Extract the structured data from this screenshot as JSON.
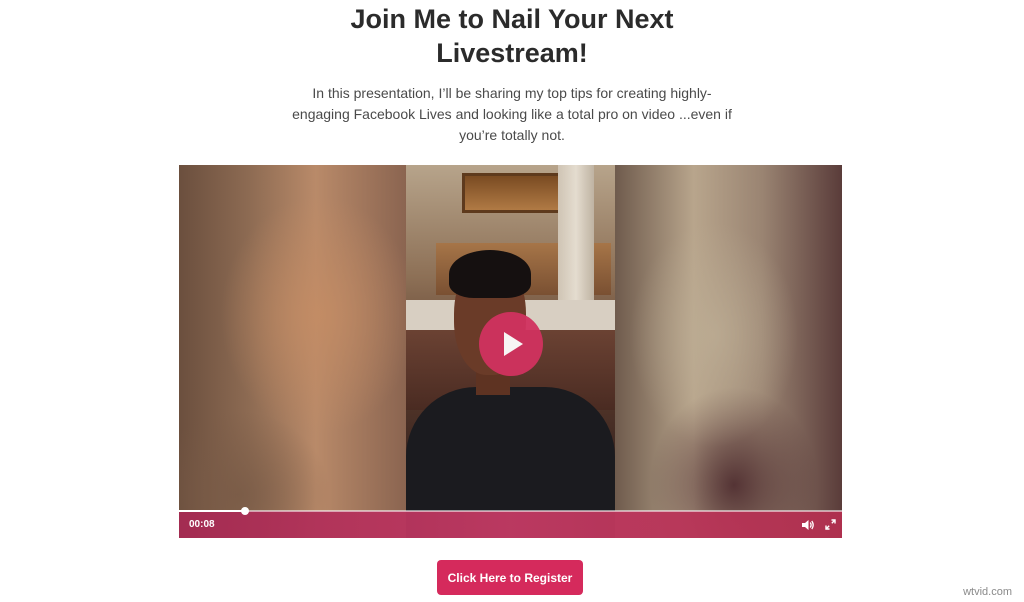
{
  "heading": {
    "line1": "Join Me to Nail Your Next",
    "line2": "Livestream!"
  },
  "description": {
    "line1": "In this presentation, I’ll be sharing my top tips for creating highly-",
    "line2": "engaging Facebook Lives and looking like a total pro on video ...even if",
    "line3": "you’re totally not."
  },
  "video": {
    "current_time": "00:08",
    "progress_fraction": 0.1,
    "accent_color": "#d1325f",
    "icons": {
      "play": "play-icon",
      "volume": "volume-icon",
      "fullscreen": "fullscreen-icon"
    }
  },
  "cta": {
    "register_label": "Click Here to Register",
    "color": "#d52a5c"
  },
  "watermark": {
    "text": "wtvid.com"
  }
}
